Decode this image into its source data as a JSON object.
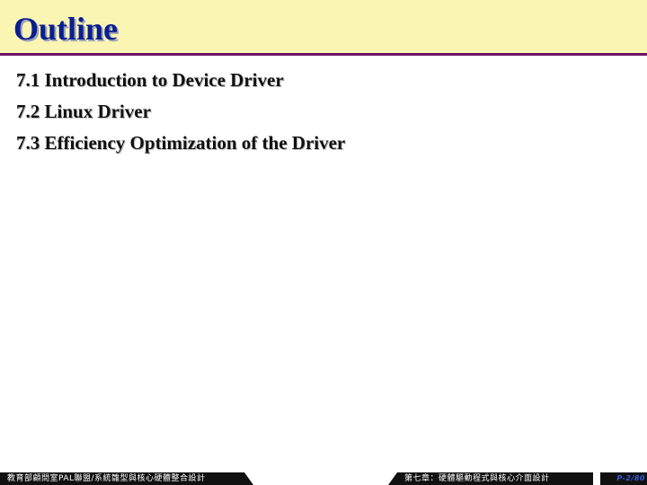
{
  "slide": {
    "title": "Outline",
    "items": [
      "7.1 Introduction to Device Driver",
      "7.2 Linux Driver",
      "7.3 Efficiency Optimization of the Driver"
    ]
  },
  "footer": {
    "left_text": "教育部顧問室PAL聯盟/系統雛型與核心硬體整合設計",
    "center_text": "第七章：硬體驅動程式與核心介面設計",
    "page_number": "P-2/80"
  },
  "colors": {
    "title_band": "#fbf5b4",
    "title_text": "#0a1f8f",
    "title_rule": "#6b1566",
    "footer_band": "#111111",
    "page_number": "#3a5bd9"
  }
}
